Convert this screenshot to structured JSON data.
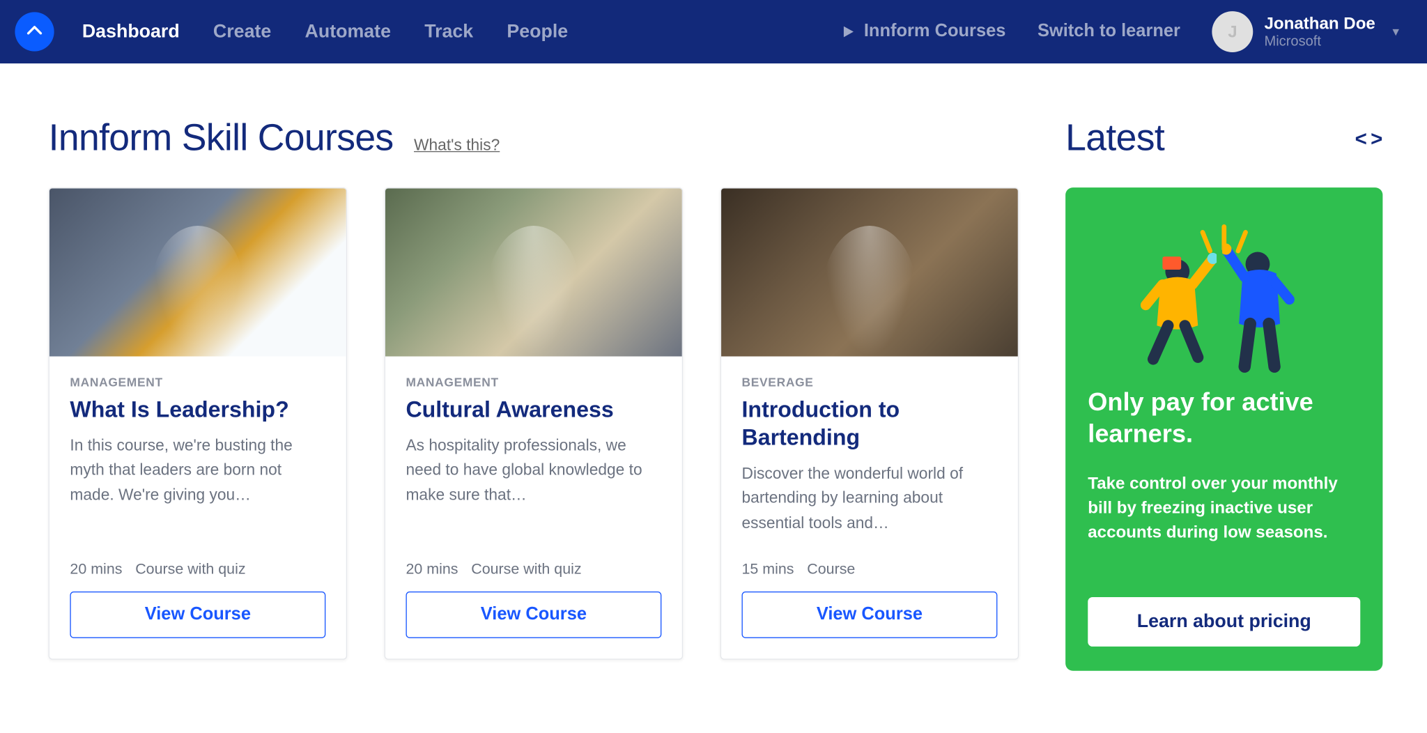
{
  "nav": {
    "items": [
      {
        "label": "Dashboard",
        "active": true
      },
      {
        "label": "Create",
        "active": false
      },
      {
        "label": "Automate",
        "active": false
      },
      {
        "label": "Track",
        "active": false
      },
      {
        "label": "People",
        "active": false
      }
    ],
    "innform_courses": "Innform Courses",
    "switch_to_learner": "Switch to learner"
  },
  "user": {
    "initial": "J",
    "name": "Jonathan Doe",
    "org": "Microsoft"
  },
  "section": {
    "title": "Innform Skill Courses",
    "whats_this": "What's this?"
  },
  "latest": {
    "title": "Latest"
  },
  "courses": [
    {
      "category": "MANAGEMENT",
      "title": "What Is Leadership?",
      "desc": "In this course, we're busting the myth that leaders are born not made. We're giving you…",
      "duration": "20 mins",
      "type": "Course with quiz",
      "cta": "View Course",
      "thumb": "thumb-1"
    },
    {
      "category": "MANAGEMENT",
      "title": "Cultural Awareness",
      "desc": "As hospitality professionals, we need to have global knowledge to make sure that…",
      "duration": "20 mins",
      "type": "Course with quiz",
      "cta": "View Course",
      "thumb": "thumb-2"
    },
    {
      "category": "BEVERAGE",
      "title": "Introduction to Bartending",
      "desc": "Discover the wonderful world of bartending by learning about essential tools and…",
      "duration": "15 mins",
      "type": "Course",
      "cta": "View Course",
      "thumb": "thumb-3"
    }
  ],
  "promo": {
    "title": "Only pay for active learners.",
    "text": "Take control over your monthly bill by freezing inactive user accounts during low seasons.",
    "cta": "Learn about pricing"
  }
}
